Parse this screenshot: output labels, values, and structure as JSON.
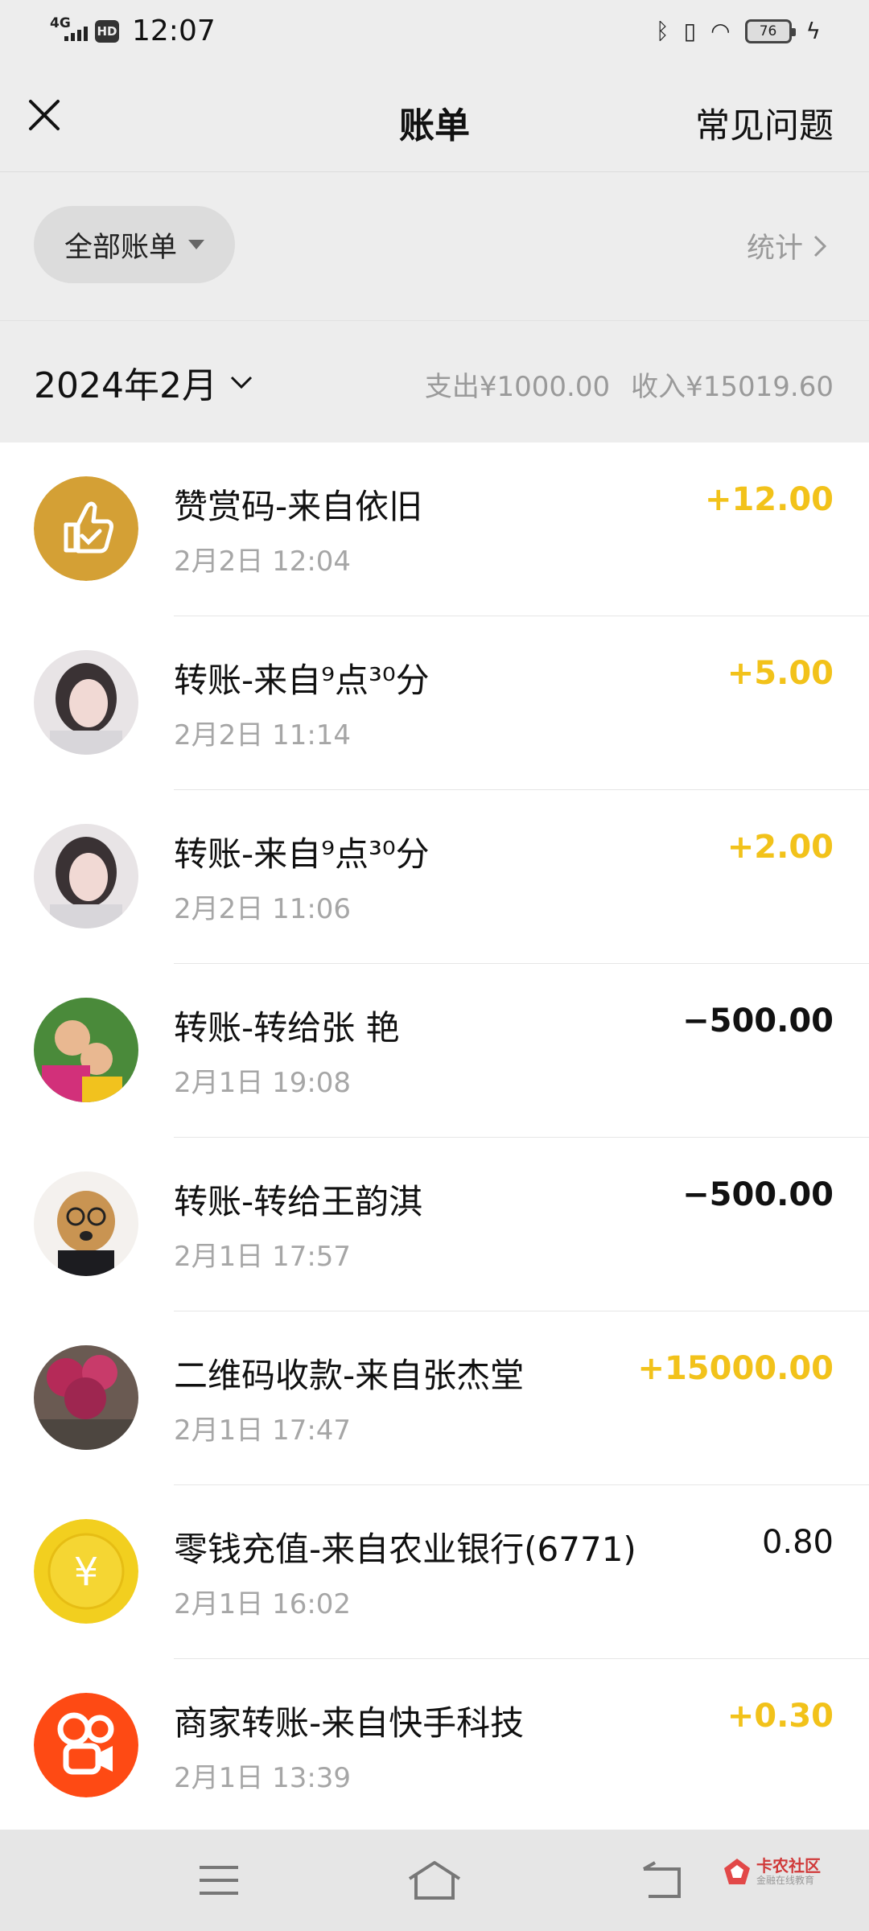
{
  "status_bar": {
    "network": "4G",
    "hd": "HD",
    "time": "12:07",
    "battery": "76"
  },
  "header": {
    "title": "账单",
    "faq_label": "常见问题"
  },
  "filter": {
    "label": "全部账单",
    "stats_label": "统计"
  },
  "month_bar": {
    "month": "2024年2月",
    "expense": "支出¥1000.00",
    "income": "收入¥15019.60"
  },
  "transactions": [
    {
      "title": "赞赏码-来自依旧",
      "time": "2月2日 12:04",
      "amount": "+12.00",
      "type": "income",
      "avatar": "thumbs-up-icon"
    },
    {
      "title": "转账-来自⁹点³⁰分",
      "time": "2月2日 11:14",
      "amount": "+5.00",
      "type": "income",
      "avatar": "user-avatar"
    },
    {
      "title": "转账-来自⁹点³⁰分",
      "time": "2月2日 11:06",
      "amount": "+2.00",
      "type": "income",
      "avatar": "user-avatar"
    },
    {
      "title": "转账-转给张 艳",
      "time": "2月1日 19:08",
      "amount": "−500.00",
      "type": "expense",
      "avatar": "user-avatar"
    },
    {
      "title": "转账-转给王韵淇",
      "time": "2月1日 17:57",
      "amount": "−500.00",
      "type": "expense",
      "avatar": "dog-avatar"
    },
    {
      "title": "二维码收款-来自张杰堂",
      "time": "2月1日 17:47",
      "amount": "+15000.00",
      "type": "income",
      "avatar": "flower-avatar"
    },
    {
      "title": "零钱充值-来自农业银行(6771)",
      "time": "2月1日 16:02",
      "amount": "0.80",
      "type": "neutral",
      "avatar": "yuan-coin-icon"
    },
    {
      "title": "商家转账-来自快手科技",
      "time": "2月1日 13:39",
      "amount": "+0.30",
      "type": "income",
      "avatar": "kuaishou-logo-icon"
    }
  ],
  "watermark": {
    "label": "卡农社区",
    "sub": "金融在线教育"
  },
  "colors": {
    "income": "#f2c21a",
    "expense": "#111111",
    "background": "#ededed",
    "list_background": "#ffffff"
  }
}
